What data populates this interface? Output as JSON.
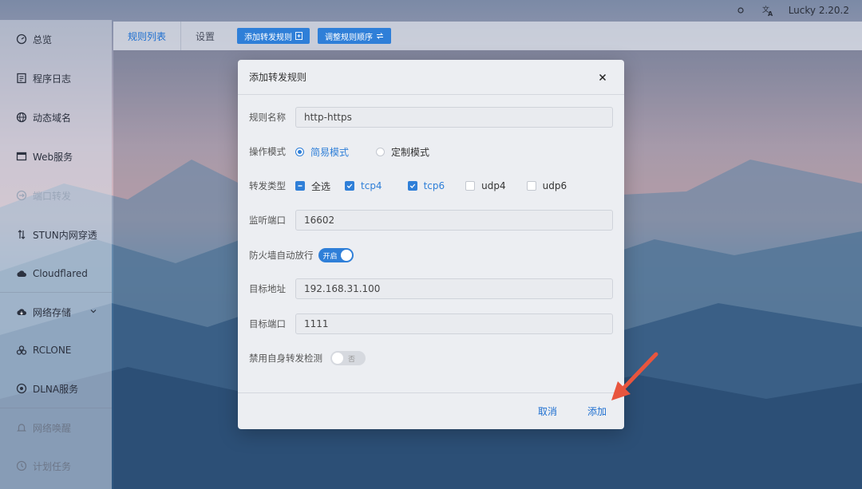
{
  "topbar": {
    "version": "Lucky 2.20.2",
    "theme_icon": "sun-icon",
    "lang_icon": "translate-icon"
  },
  "sidebar": {
    "items": [
      {
        "label": "总览",
        "icon": "dashboard-icon"
      },
      {
        "label": "程序日志",
        "icon": "log-icon"
      },
      {
        "label": "动态域名",
        "icon": "ddns-icon"
      },
      {
        "label": "Web服务",
        "icon": "web-icon"
      },
      {
        "label": "端口转发",
        "icon": "port-forward-icon"
      },
      {
        "label": "STUN内网穿透",
        "icon": "stun-icon"
      },
      {
        "label": "Cloudflared",
        "icon": "cloud-icon"
      },
      {
        "label": "网络存储",
        "icon": "storage-icon"
      },
      {
        "label": "RCLONE",
        "icon": "rclone-icon"
      },
      {
        "label": "DLNA服务",
        "icon": "dlna-icon"
      },
      {
        "label": "网络唤醒",
        "icon": "wake-icon"
      },
      {
        "label": "计划任务",
        "icon": "schedule-icon"
      }
    ]
  },
  "tabs": {
    "list": "规则列表",
    "settings": "设置",
    "add_rule": "添加转发规则",
    "reorder": "调整规则顺序"
  },
  "dialog": {
    "title": "添加转发规则",
    "rule_name_label": "规则名称",
    "rule_name_value": "http-https",
    "mode_label": "操作模式",
    "mode_simple": "简易模式",
    "mode_custom": "定制模式",
    "type_label": "转发类型",
    "type_all": "全选",
    "type_tcp4": "tcp4",
    "type_tcp6": "tcp6",
    "type_udp4": "udp4",
    "type_udp6": "udp6",
    "listen_port_label": "监听端口",
    "listen_port_value": "16602",
    "firewall_label": "防火墙自动放行",
    "firewall_state": "开启",
    "target_addr_label": "目标地址",
    "target_addr_value": "192.168.31.100",
    "target_port_label": "目标端口",
    "target_port_value": "1111",
    "disable_self_label": "禁用自身转发检测",
    "disable_self_state": "否",
    "cancel": "取消",
    "add": "添加"
  },
  "colors": {
    "accent": "#2f7fd8",
    "annotation_arrow": "#e8553e"
  }
}
